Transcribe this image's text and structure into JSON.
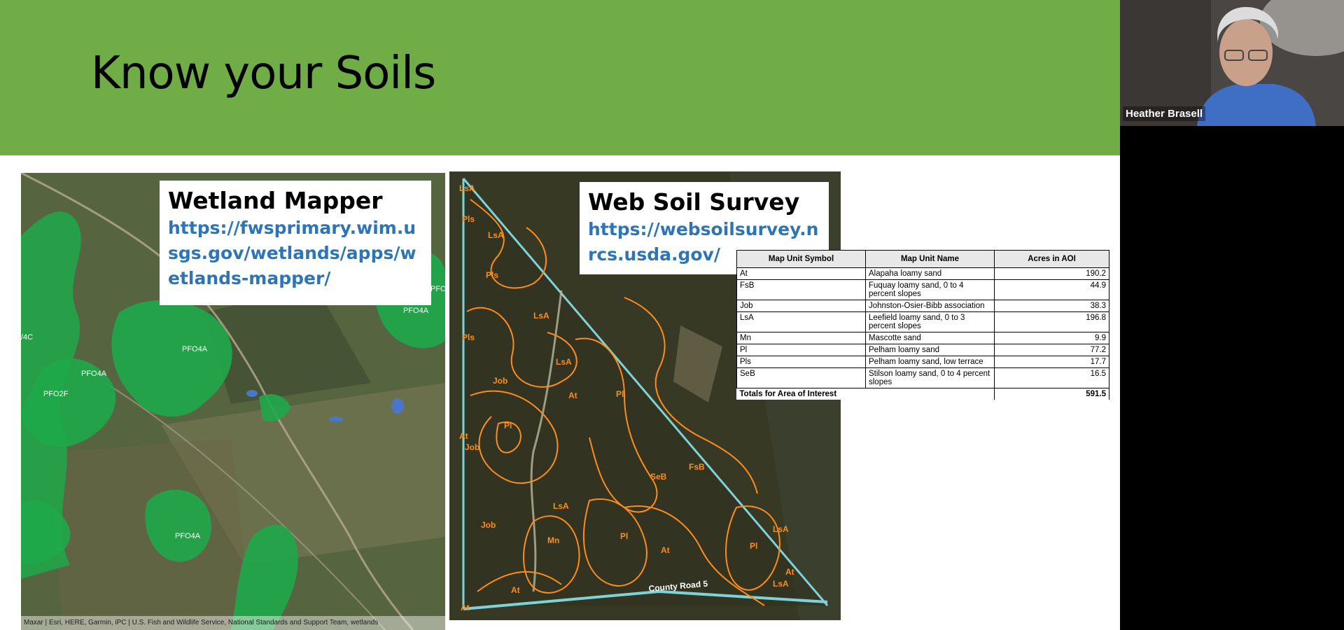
{
  "slide": {
    "title": "Know your Soils",
    "wetland": {
      "title": "Wetland Mapper",
      "link": "https://fwsprimary.wim.usgs.gov/wetlands/apps/wetlands-mapper/",
      "attribution": "Maxar | Esri, HERE, Garmin, iPC | U.S. Fish and Wildlife Service, National Standards and Support Team, wetlands",
      "map_labels": [
        "PFO4A",
        "PFO4A",
        "PFO2F",
        "PFO4A",
        "PFO4A",
        "/4C",
        "PFC"
      ]
    },
    "soil_survey": {
      "title": "Web Soil Survey",
      "link": "https://websoilsurvey.nrcs.usda.gov/",
      "road_label": "County Road 5",
      "map_labels": [
        "LsA",
        "Pls",
        "LsA",
        "Pls",
        "LsA",
        "Pls",
        "Job",
        "LsA",
        "At",
        "Pl",
        "Pl",
        "At",
        "Job",
        "SeB",
        "FsB",
        "Job",
        "LsA",
        "Mn",
        "Pl",
        "At",
        "Pl",
        "LsA",
        "At",
        "LsA",
        "At",
        "At"
      ]
    },
    "table": {
      "headers": [
        "Map Unit Symbol",
        "Map Unit Name",
        "Acres in AOI"
      ],
      "rows": [
        [
          "At",
          "Alapaha loamy sand",
          "190.2"
        ],
        [
          "FsB",
          "Fuquay loamy sand, 0 to 4 percent slopes",
          "44.9"
        ],
        [
          "Job",
          "Johnston-Osier-Bibb association",
          "38.3"
        ],
        [
          "LsA",
          "Leefield loamy sand, 0 to 3 percent slopes",
          "196.8"
        ],
        [
          "Mn",
          "Mascotte sand",
          "9.9"
        ],
        [
          "Pl",
          "Pelham loamy sand",
          "77.2"
        ],
        [
          "Pls",
          "Pelham loamy sand, low terrace",
          "17.7"
        ],
        [
          "SeB",
          "Stilson loamy sand, 0 to 4 percent slopes",
          "16.5"
        ]
      ],
      "total_label": "Totals for Area of Interest",
      "total_value": "591.5"
    }
  },
  "video": {
    "participant_name": "Heather Brasell"
  },
  "colors": {
    "banner": "#70ad47",
    "link": "#2e75b6",
    "wetland_fill": "#1fa84a",
    "soil_line": "#ff8c1a",
    "boundary": "#7fd3d8"
  }
}
